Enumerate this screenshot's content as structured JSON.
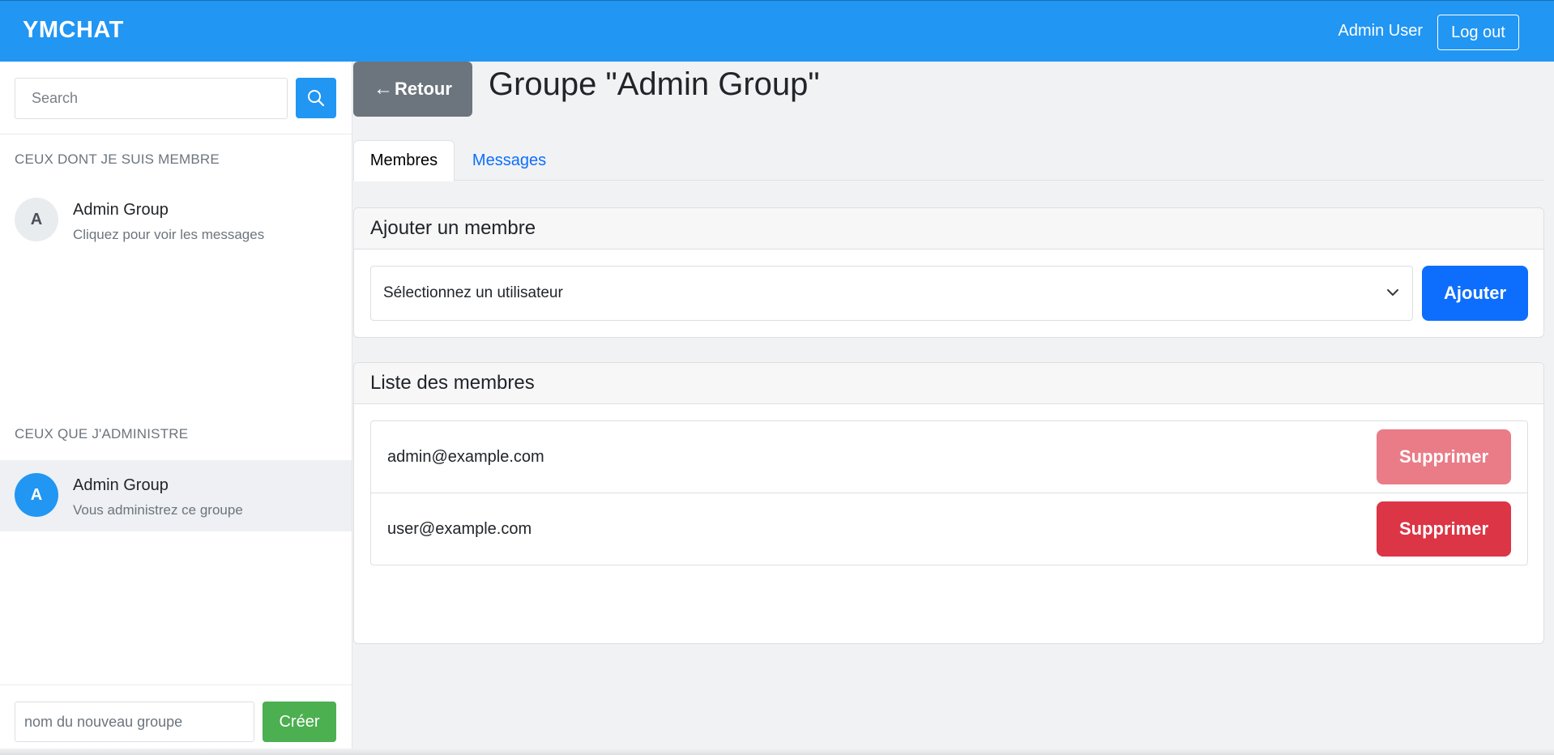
{
  "navbar": {
    "brand": "YMCHAT",
    "user_name": "Admin User",
    "logout_label": "Log out"
  },
  "sidebar": {
    "search_placeholder": "Search",
    "member_section_title": "CEUX DONT JE SUIS MEMBRE",
    "member_groups": [
      {
        "initial": "A",
        "name": "Admin Group",
        "subtitle": "Cliquez pour voir les messages"
      }
    ],
    "admin_section_title": "CEUX QUE J'ADMINISTRE",
    "admin_groups": [
      {
        "initial": "A",
        "name": "Admin Group",
        "subtitle": "Vous administrez ce groupe"
      }
    ],
    "new_group_placeholder": "nom du nouveau groupe",
    "create_label": "Créer"
  },
  "main": {
    "back_arrow": "←",
    "back_label": "Retour",
    "title": "Groupe \"Admin Group\"",
    "tabs": [
      {
        "label": "Membres",
        "active": true
      },
      {
        "label": "Messages",
        "active": false
      }
    ],
    "add_member": {
      "header": "Ajouter un membre",
      "select_value": "Sélectionnez un utilisateur",
      "add_label": "Ajouter"
    },
    "member_list": {
      "header": "Liste des membres",
      "members": [
        {
          "email": "admin@example.com",
          "action_label": "Supprimer",
          "disabled": true
        },
        {
          "email": "user@example.com",
          "action_label": "Supprimer",
          "disabled": false
        }
      ]
    }
  },
  "colors": {
    "primary": "#2196f3",
    "create": "#4caf50",
    "add": "#0d6efd",
    "danger": "#dc3545",
    "danger_disabled": "#e97c87",
    "secondary": "#6c757d"
  }
}
